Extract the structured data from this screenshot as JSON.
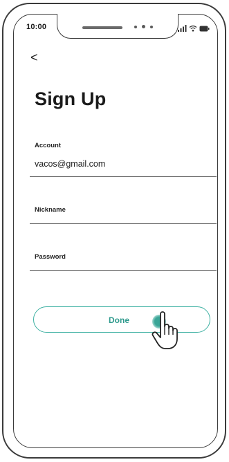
{
  "status_bar": {
    "time": "10:00"
  },
  "nav": {
    "back_glyph": "<"
  },
  "screen": {
    "title": "Sign Up",
    "fields": [
      {
        "label": "Account",
        "value": "vacos@gmail.com"
      },
      {
        "label": "Nickname",
        "value": ""
      },
      {
        "label": "Password",
        "value": ""
      }
    ],
    "done_button": {
      "label": "Done"
    }
  },
  "icons": [
    "signal-icon",
    "wifi-icon",
    "battery-icon",
    "hand-pointer-icon",
    "back-chevron-icon"
  ],
  "colors": {
    "accent": "#3fb1a3",
    "accent_text": "#2e9a8d",
    "frame": "#3a3a3a"
  }
}
